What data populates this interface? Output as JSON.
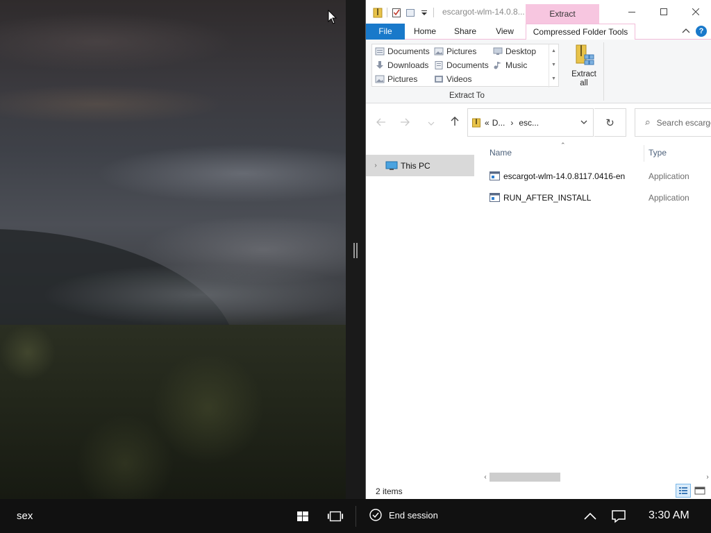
{
  "window": {
    "title": "escargot-wlm-14.0.8...",
    "context_tab": "Extract"
  },
  "ribbon": {
    "tabs": [
      "File",
      "Home",
      "Share",
      "View",
      "Compressed Folder Tools"
    ],
    "gallery_items": [
      "Documents",
      "Pictures",
      "Desktop",
      "Downloads",
      "Documents",
      "Music",
      "Pictures",
      "Videos"
    ],
    "group_label": "Extract To",
    "extract_all_label": "Extract all"
  },
  "address": {
    "breadcrumb_1": "D...",
    "breadcrumb_2": "esc...",
    "search_placeholder": "Search escargot"
  },
  "nav_pane": {
    "items": [
      {
        "label": "This PC"
      }
    ]
  },
  "file_list": {
    "columns": [
      "Name",
      "Type"
    ],
    "rows": [
      {
        "name": "escargot-wlm-14.0.8117.0416-en",
        "type": "Application"
      },
      {
        "name": "RUN_AFTER_INSTALL",
        "type": "Application"
      }
    ]
  },
  "status": {
    "item_count": "2 items"
  },
  "taskbar": {
    "label": "sex",
    "end_session": "End session",
    "clock": "3:30 AM"
  },
  "colors": {
    "file_tab": "#1979ca",
    "context_pink": "#f7c6e0",
    "taskbar": "#111111"
  }
}
